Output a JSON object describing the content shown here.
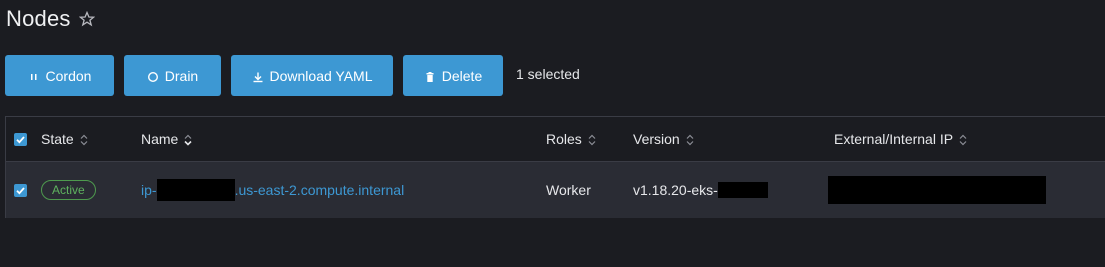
{
  "header": {
    "title": "Nodes"
  },
  "toolbar": {
    "cordon_label": "Cordon",
    "drain_label": "Drain",
    "download_label": "Download YAML",
    "delete_label": "Delete",
    "selected_text": "1 selected"
  },
  "table": {
    "columns": {
      "state": "State",
      "name": "Name",
      "roles": "Roles",
      "version": "Version",
      "ip": "External/Internal IP"
    },
    "rows": [
      {
        "state": "Active",
        "name_prefix": "ip-",
        "name_suffix": ".us-east-2.compute.internal",
        "roles": "Worker",
        "version_prefix": "v1.18.20-eks-"
      }
    ]
  },
  "colors": {
    "accent": "#3d98d3",
    "background": "#1b1c21",
    "row_background": "#2a2c34",
    "active_green": "#5fb35f"
  }
}
